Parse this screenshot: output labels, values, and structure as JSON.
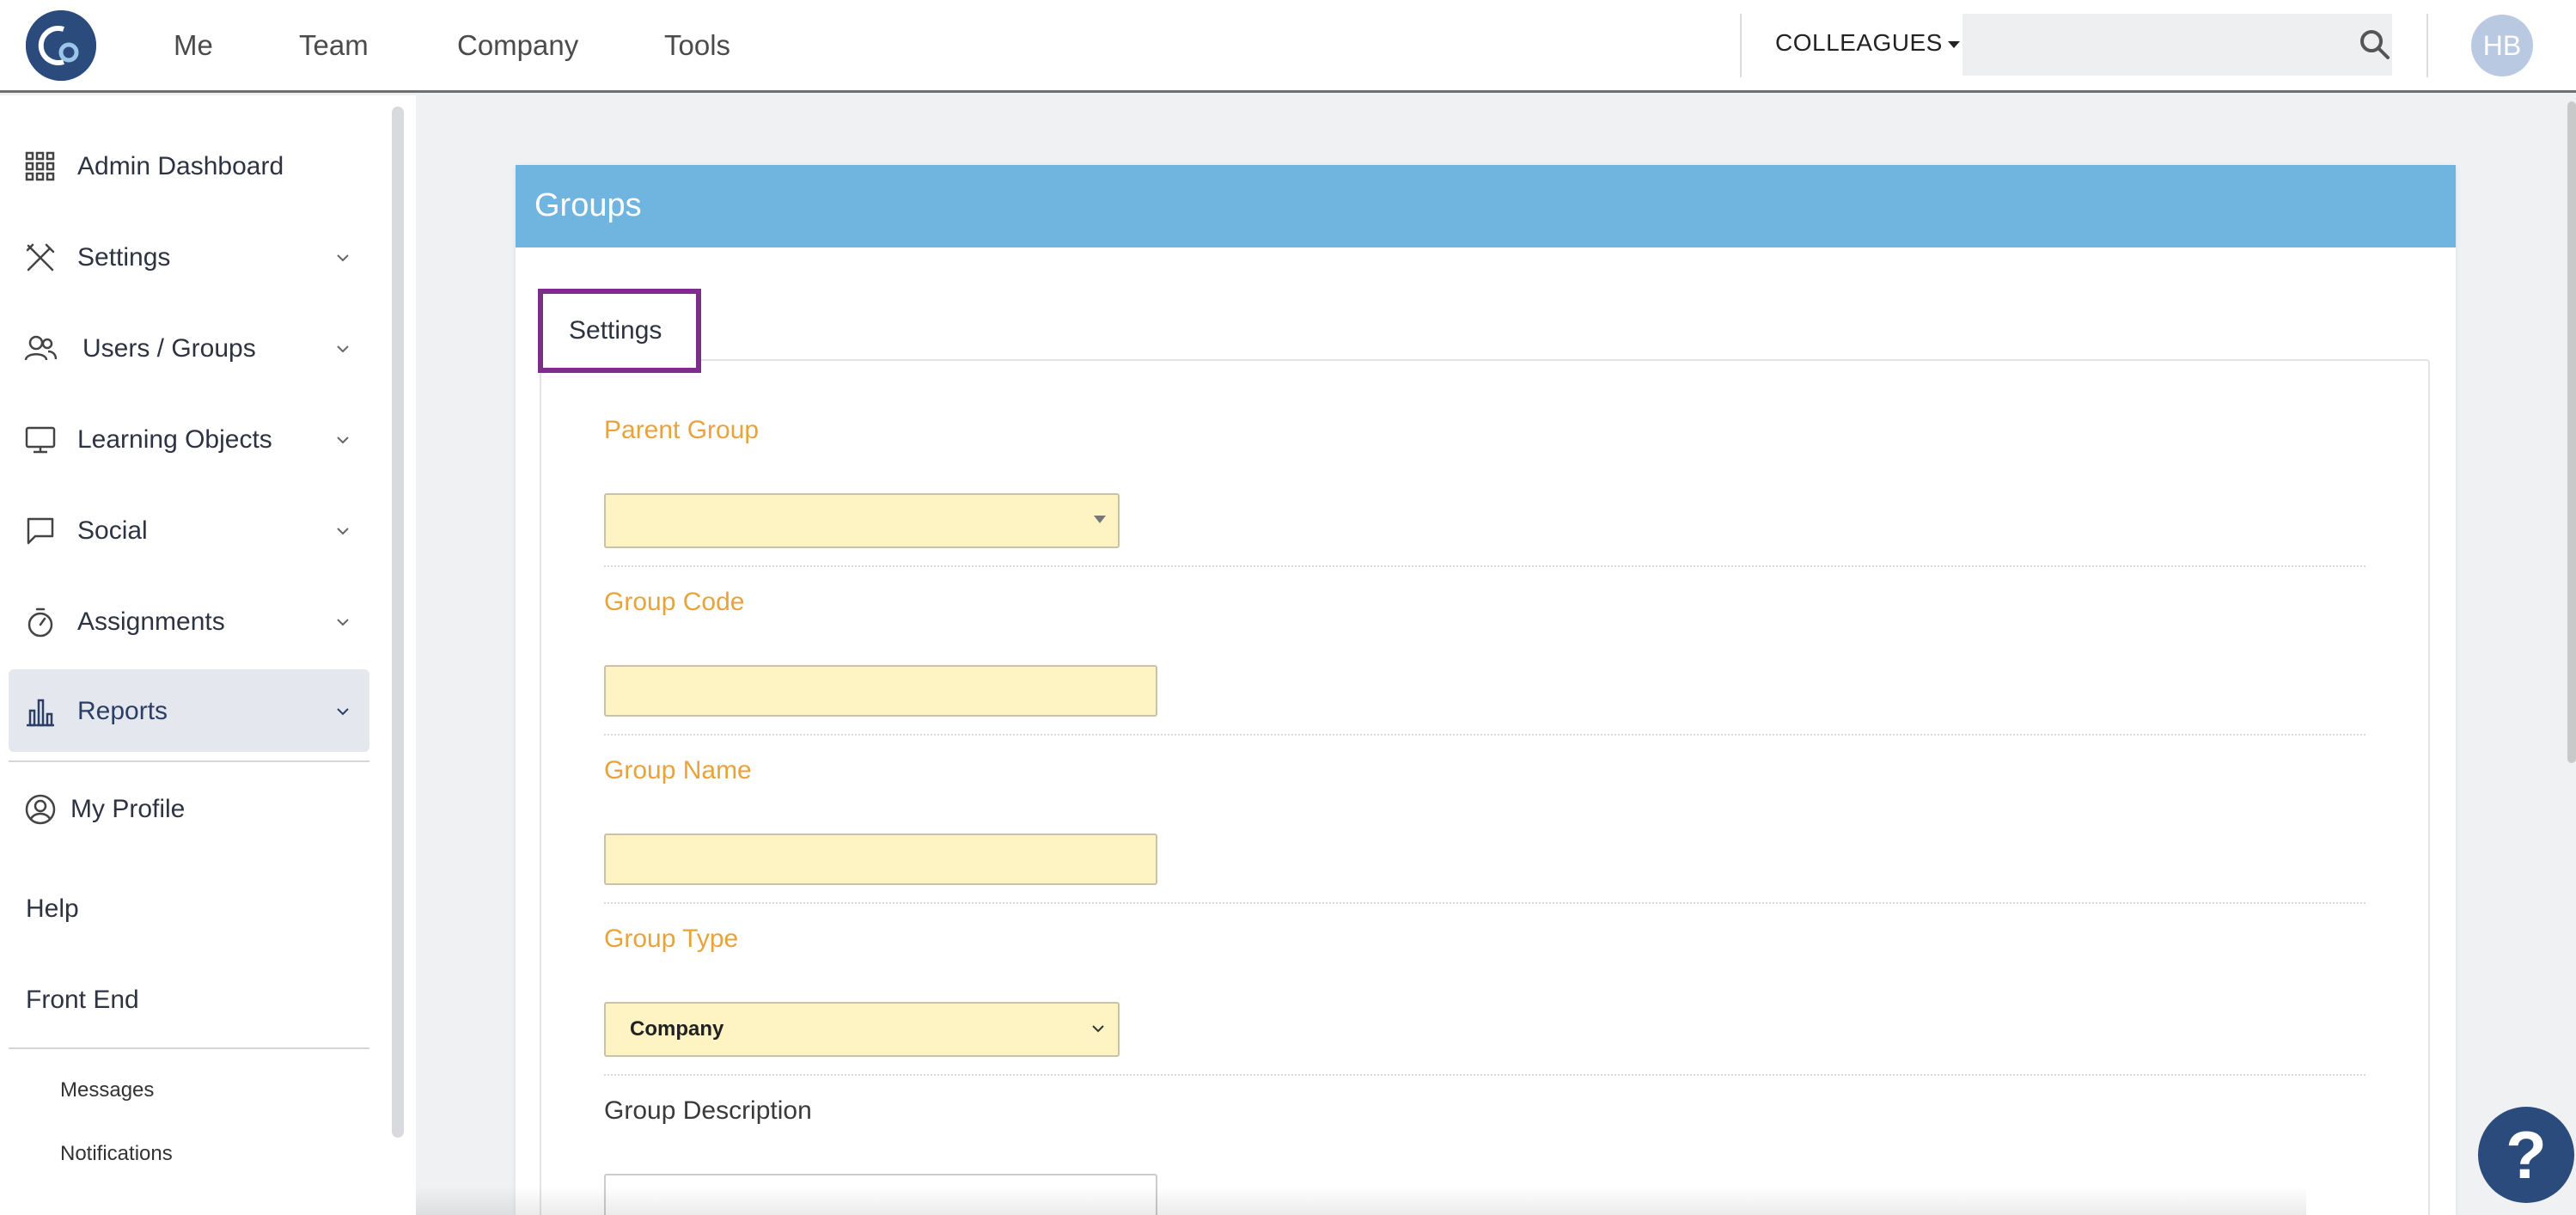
{
  "topnav": {
    "links": [
      "Me",
      "Team",
      "Company",
      "Tools"
    ],
    "colleagues_label": "COLLEAGUES",
    "search_placeholder": "",
    "avatar_initials": "HB"
  },
  "sidebar": {
    "items": [
      {
        "label": "Admin Dashboard",
        "icon": "grid-icon"
      },
      {
        "label": "Settings",
        "icon": "tools-icon"
      },
      {
        "label": "Users / Groups",
        "icon": "users-icon"
      },
      {
        "label": "Learning Objects",
        "icon": "monitor-icon"
      },
      {
        "label": "Social",
        "icon": "chat-icon"
      },
      {
        "label": "Assignments",
        "icon": "stopwatch-icon"
      },
      {
        "label": "Reports",
        "icon": "bar-chart-icon"
      }
    ],
    "my_profile": "My Profile",
    "help": "Help",
    "front_end": "Front End",
    "messages": "Messages",
    "notifications": "Notifications"
  },
  "panel": {
    "title": "Groups",
    "tab": "Settings"
  },
  "form": {
    "parent_group_label": "Parent Group",
    "parent_group_value": "",
    "group_code_label": "Group Code",
    "group_code_value": "",
    "group_name_label": "Group Name",
    "group_name_value": "",
    "group_type_label": "Group Type",
    "group_type_value": "Company",
    "group_description_label": "Group Description"
  },
  "help_button": "?",
  "colors": {
    "accent_blue": "#6fb5e0",
    "brand_navy": "#2a4b7c",
    "label_orange": "#e8a33a",
    "highlight_purple": "#7e2d8d",
    "field_yellow": "#fdf3c3"
  }
}
